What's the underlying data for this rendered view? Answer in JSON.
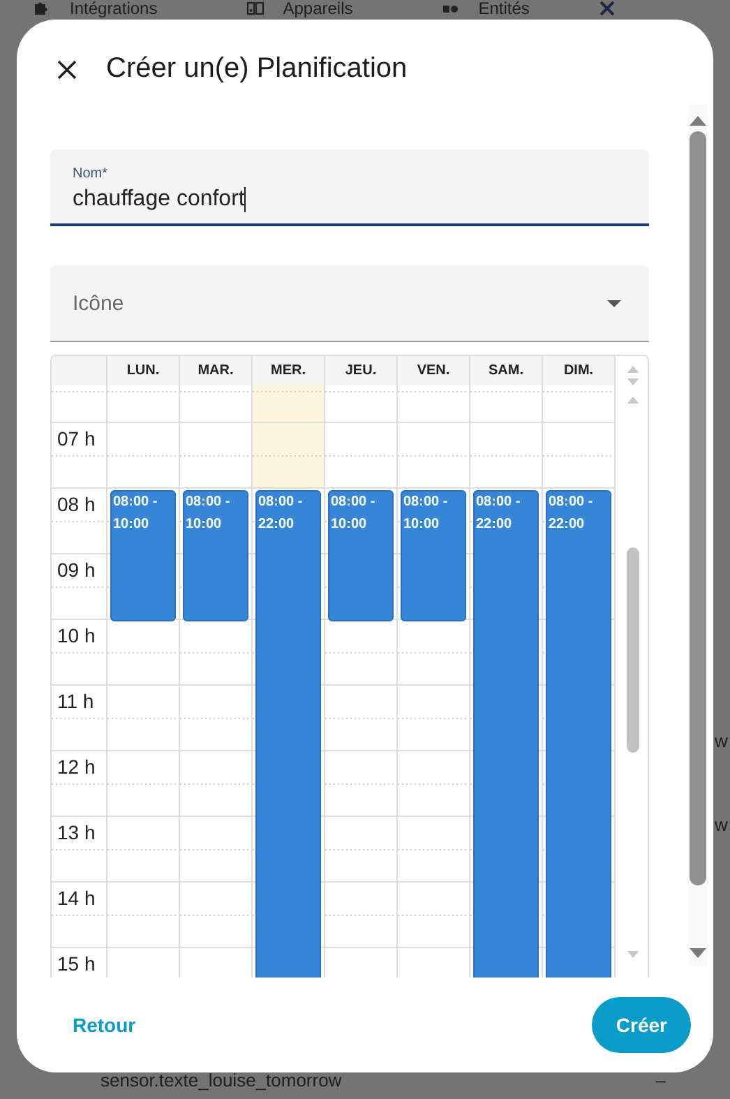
{
  "background": {
    "tabs": [
      {
        "label": "Intégrations"
      },
      {
        "label": "Appareils"
      },
      {
        "label": "Entités"
      }
    ],
    "side_texts": [
      "w",
      "w"
    ],
    "row": {
      "entity": "sensor.texte_louise_tomorrow",
      "value": "–"
    }
  },
  "dialog": {
    "title": "Créer un(e) Planification",
    "name_field": {
      "label": "Nom*",
      "value": "chauffage confort"
    },
    "icon_field": {
      "placeholder": "Icône"
    },
    "calendar": {
      "days": [
        {
          "label": "LUN.",
          "today": false,
          "events": [
            {
              "start": "08:00 -",
              "end": "10:00"
            }
          ]
        },
        {
          "label": "MAR.",
          "today": false,
          "events": [
            {
              "start": "08:00 -",
              "end": "10:00"
            }
          ]
        },
        {
          "label": "MER.",
          "today": true,
          "events": [
            {
              "start": "08:00 -",
              "end": "22:00"
            }
          ]
        },
        {
          "label": "JEU.",
          "today": false,
          "events": [
            {
              "start": "08:00 -",
              "end": "10:00"
            }
          ]
        },
        {
          "label": "VEN.",
          "today": false,
          "events": [
            {
              "start": "08:00 -",
              "end": "10:00"
            }
          ]
        },
        {
          "label": "SAM.",
          "today": false,
          "events": [
            {
              "start": "08:00 -",
              "end": "22:00"
            }
          ]
        },
        {
          "label": "DIM.",
          "today": false,
          "events": [
            {
              "start": "08:00 -",
              "end": "22:00"
            }
          ]
        }
      ],
      "hours": [
        "07 h",
        "08 h",
        "09 h",
        "10 h",
        "11 h",
        "12 h",
        "13 h",
        "14 h",
        "15 h"
      ]
    },
    "buttons": {
      "back": "Retour",
      "create": "Créer"
    }
  }
}
